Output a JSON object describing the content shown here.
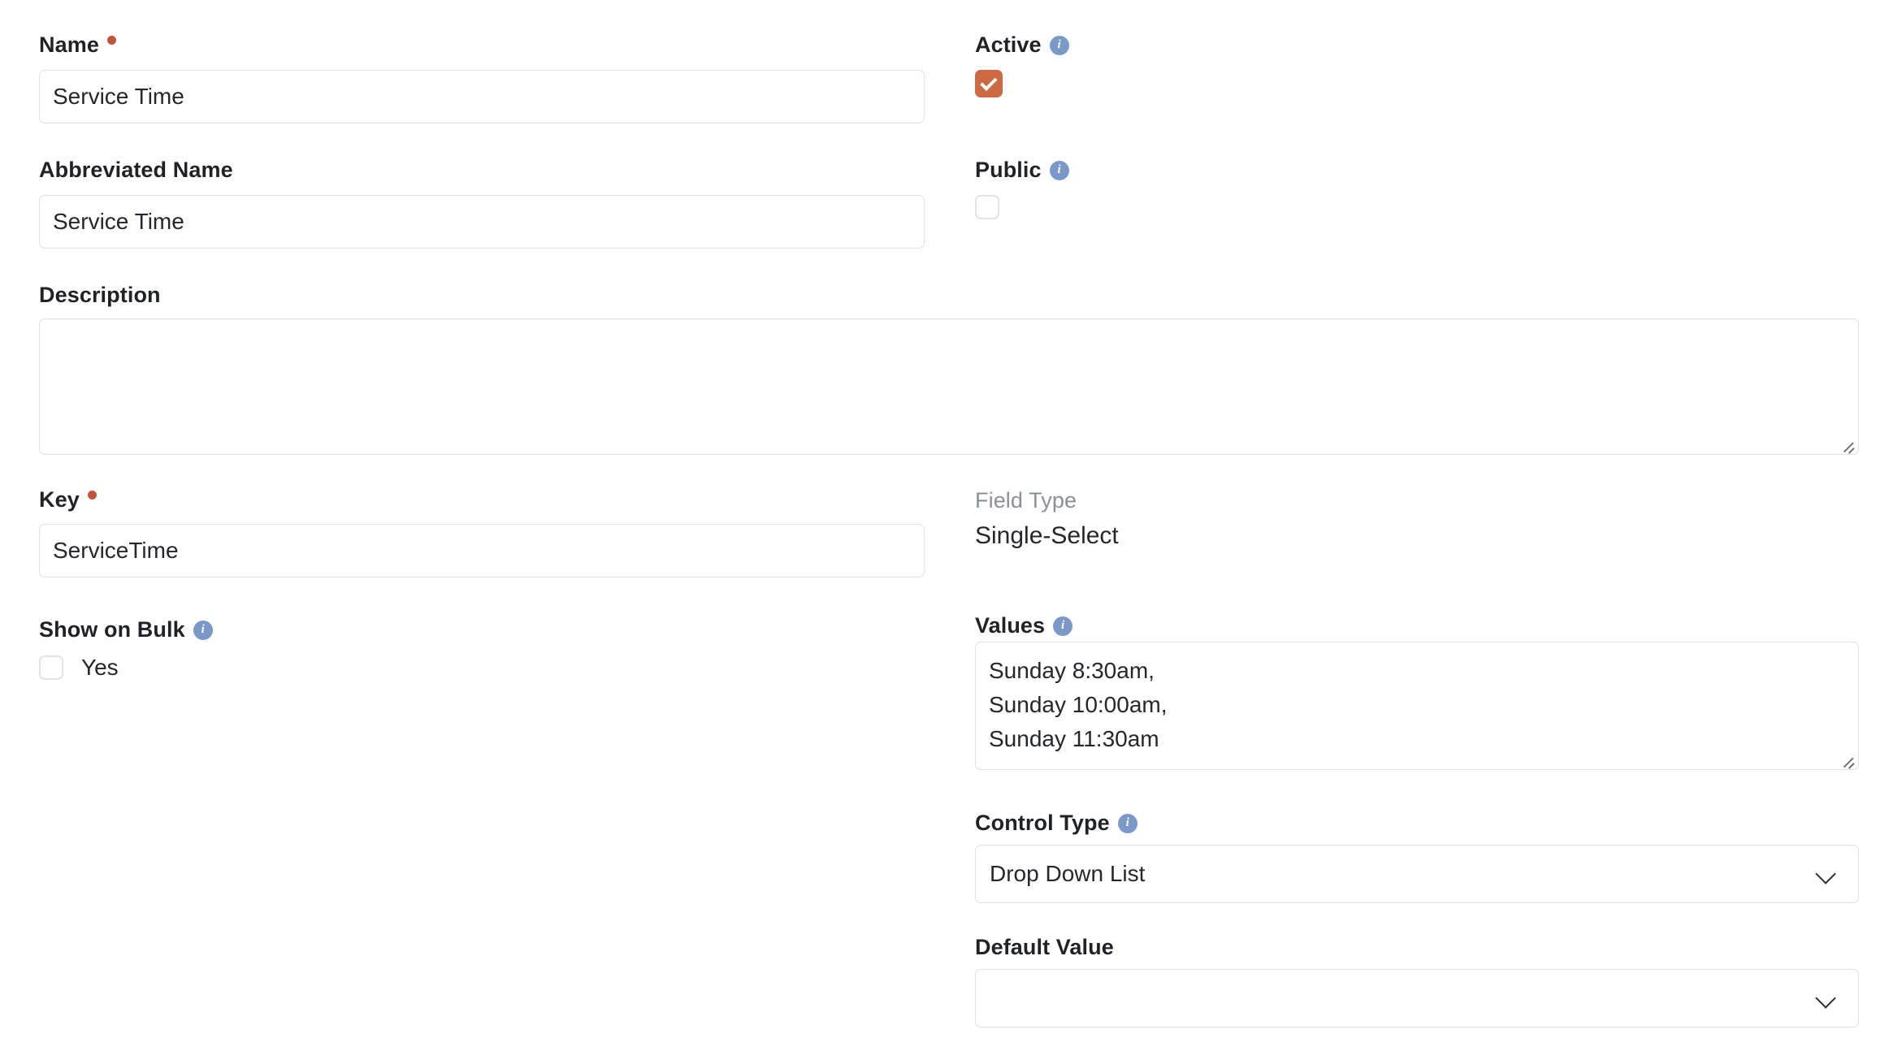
{
  "form": {
    "left_column": {
      "name": {
        "label": "Name",
        "required_marker": "required-dot",
        "value": "Service Time",
        "placeholder": ""
      },
      "abbreviated_name": {
        "label": "Abbreviated Name",
        "value": "Service Time",
        "placeholder": ""
      },
      "description": {
        "label": "Description",
        "value": "",
        "placeholder": ""
      },
      "key": {
        "label": "Key",
        "required_marker": "required-dot",
        "value": "ServiceTime",
        "placeholder": ""
      },
      "show_on_bulk": {
        "label": "Show on Bulk",
        "info": "i",
        "checkbox_label": "Yes",
        "checked": false
      }
    },
    "right_column": {
      "active": {
        "label": "Active",
        "info": "i",
        "checked": true
      },
      "public": {
        "label": "Public",
        "info": "i",
        "checked": false
      },
      "field_type": {
        "label": "Field Type",
        "value": "Single-Select"
      },
      "values": {
        "label": "Values",
        "info": "i",
        "value": "Sunday 8:30am,\nSunday 10:00am,\nSunday 11:30am",
        "placeholder": ""
      },
      "control_type": {
        "label": "Control Type",
        "info": "i",
        "value": "Drop Down List",
        "options": [
          "Drop Down List"
        ]
      },
      "default_value": {
        "label": "Default Value",
        "value": "",
        "options": []
      }
    }
  },
  "colors": {
    "accent_checked": "#cb6a43",
    "required_dot": "#c2543a",
    "info_icon": "#7a99c9",
    "border": "#dfe1e3",
    "text": "#24282c",
    "muted_text": "#8a9097"
  }
}
